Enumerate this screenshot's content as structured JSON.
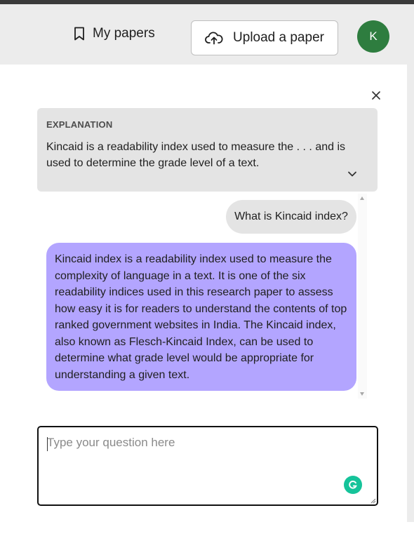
{
  "header": {
    "my_papers_label": "My papers",
    "my_papers_icon": "bookmark-icon",
    "upload_label": "Upload a paper",
    "upload_icon": "cloud-upload-icon",
    "avatar_initial": "K",
    "avatar_color": "#2e7d3f"
  },
  "explanation": {
    "heading": "EXPLANATION",
    "text": "Kincaid is a readability index used to measure the . . . and is used to determine the grade level of a text.",
    "expand_icon": "chevron-down-icon"
  },
  "chat": {
    "messages": [
      {
        "role": "user",
        "text": "What is Kincaid index?"
      },
      {
        "role": "assistant",
        "text": "Kincaid index is a readability index used to measure the complexity of language in a text. It is one of the six readability indices used in this research paper to assess how easy it is for readers to understand the contents of top ranked government websites in India. The Kincaid index, also known as Flesch-Kincaid Index, can be used to determine what grade level would be appropriate for understanding a given text."
      }
    ],
    "assistant_bubble_color": "#b3a5ff",
    "user_bubble_color": "#e4e4e4"
  },
  "input": {
    "placeholder": "Type your question here",
    "value": "",
    "assistant_icon": "grammarly-icon",
    "assistant_icon_color": "#15c39a"
  },
  "close_icon": "close-icon"
}
